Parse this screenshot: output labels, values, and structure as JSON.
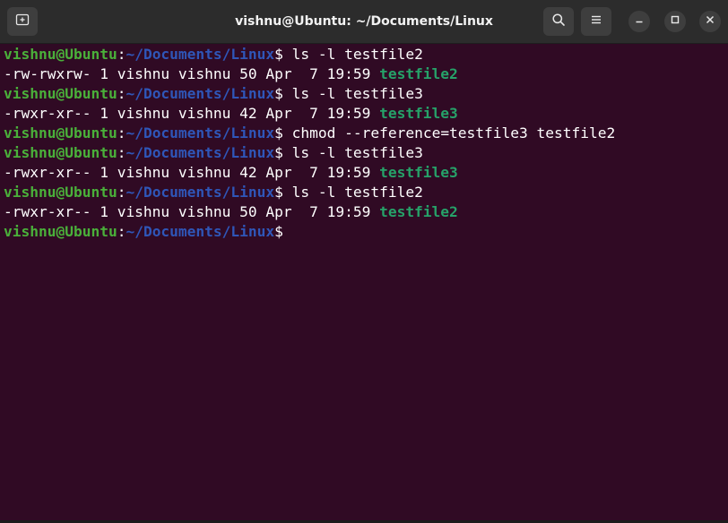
{
  "window": {
    "title": "vishnu@Ubuntu: ~/Documents/Linux"
  },
  "header": {
    "new_tab_icon": "new-tab-icon",
    "search_icon": "search-icon",
    "menu_icon": "hamburger-menu-icon",
    "minimize_icon": "minimize-icon",
    "maximize_icon": "maximize-icon",
    "close_icon": "close-icon"
  },
  "prompt": {
    "user": "vishnu@Ubuntu",
    "sep": ":",
    "path": "~/Documents/Linux",
    "sign": "$"
  },
  "lines": [
    {
      "type": "cmd",
      "command": " ls -l testfile2"
    },
    {
      "type": "out",
      "text": "-rw-rwxrw- 1 vishnu vishnu 50 Apr  7 19:59 ",
      "file": "testfile2"
    },
    {
      "type": "cmd",
      "command": " ls -l testfile3"
    },
    {
      "type": "out",
      "text": "-rwxr-xr-- 1 vishnu vishnu 42 Apr  7 19:59 ",
      "file": "testfile3"
    },
    {
      "type": "cmd",
      "command": " chmod --reference=testfile3 testfile2"
    },
    {
      "type": "cmd",
      "command": " ls -l testfile3"
    },
    {
      "type": "out",
      "text": "-rwxr-xr-- 1 vishnu vishnu 42 Apr  7 19:59 ",
      "file": "testfile3"
    },
    {
      "type": "cmd",
      "command": " ls -l testfile2"
    },
    {
      "type": "out",
      "text": "-rwxr-xr-- 1 vishnu vishnu 50 Apr  7 19:59 ",
      "file": "testfile2"
    },
    {
      "type": "cmd",
      "command": ""
    }
  ],
  "colors": {
    "background": "#300a24",
    "user": "#4ab03a",
    "path": "#2f56b8",
    "file": "#26a269",
    "titlebar": "#2c2c2c"
  }
}
